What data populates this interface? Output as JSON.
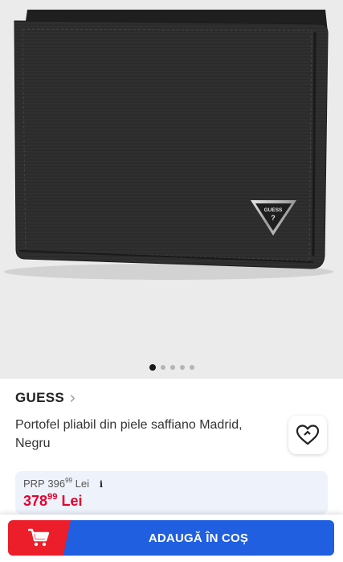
{
  "gallery": {
    "logo_text": "GUESS",
    "image_count": 5,
    "active_index": 0
  },
  "product": {
    "brand": "GUESS",
    "title": "Portofel pliabil din piele saffiano Madrid, Negru"
  },
  "price": {
    "prp_label": "PRP",
    "prp_int": "396",
    "prp_dec": "99",
    "prp_currency": "Lei",
    "info_symbol": "i",
    "current_int": "378",
    "current_dec": "99",
    "current_currency": "Lei"
  },
  "cta": {
    "label": "ADAUGĂ ÎN COȘ"
  },
  "colors": {
    "price_red": "#e4002b",
    "cta_blue": "#1f5fe0",
    "cart_red": "#ec1e2a"
  },
  "icons": {
    "brand_chevron": "chevron-right-icon",
    "favorite": "heart-icon",
    "info": "info-icon",
    "cart": "cart-icon"
  }
}
